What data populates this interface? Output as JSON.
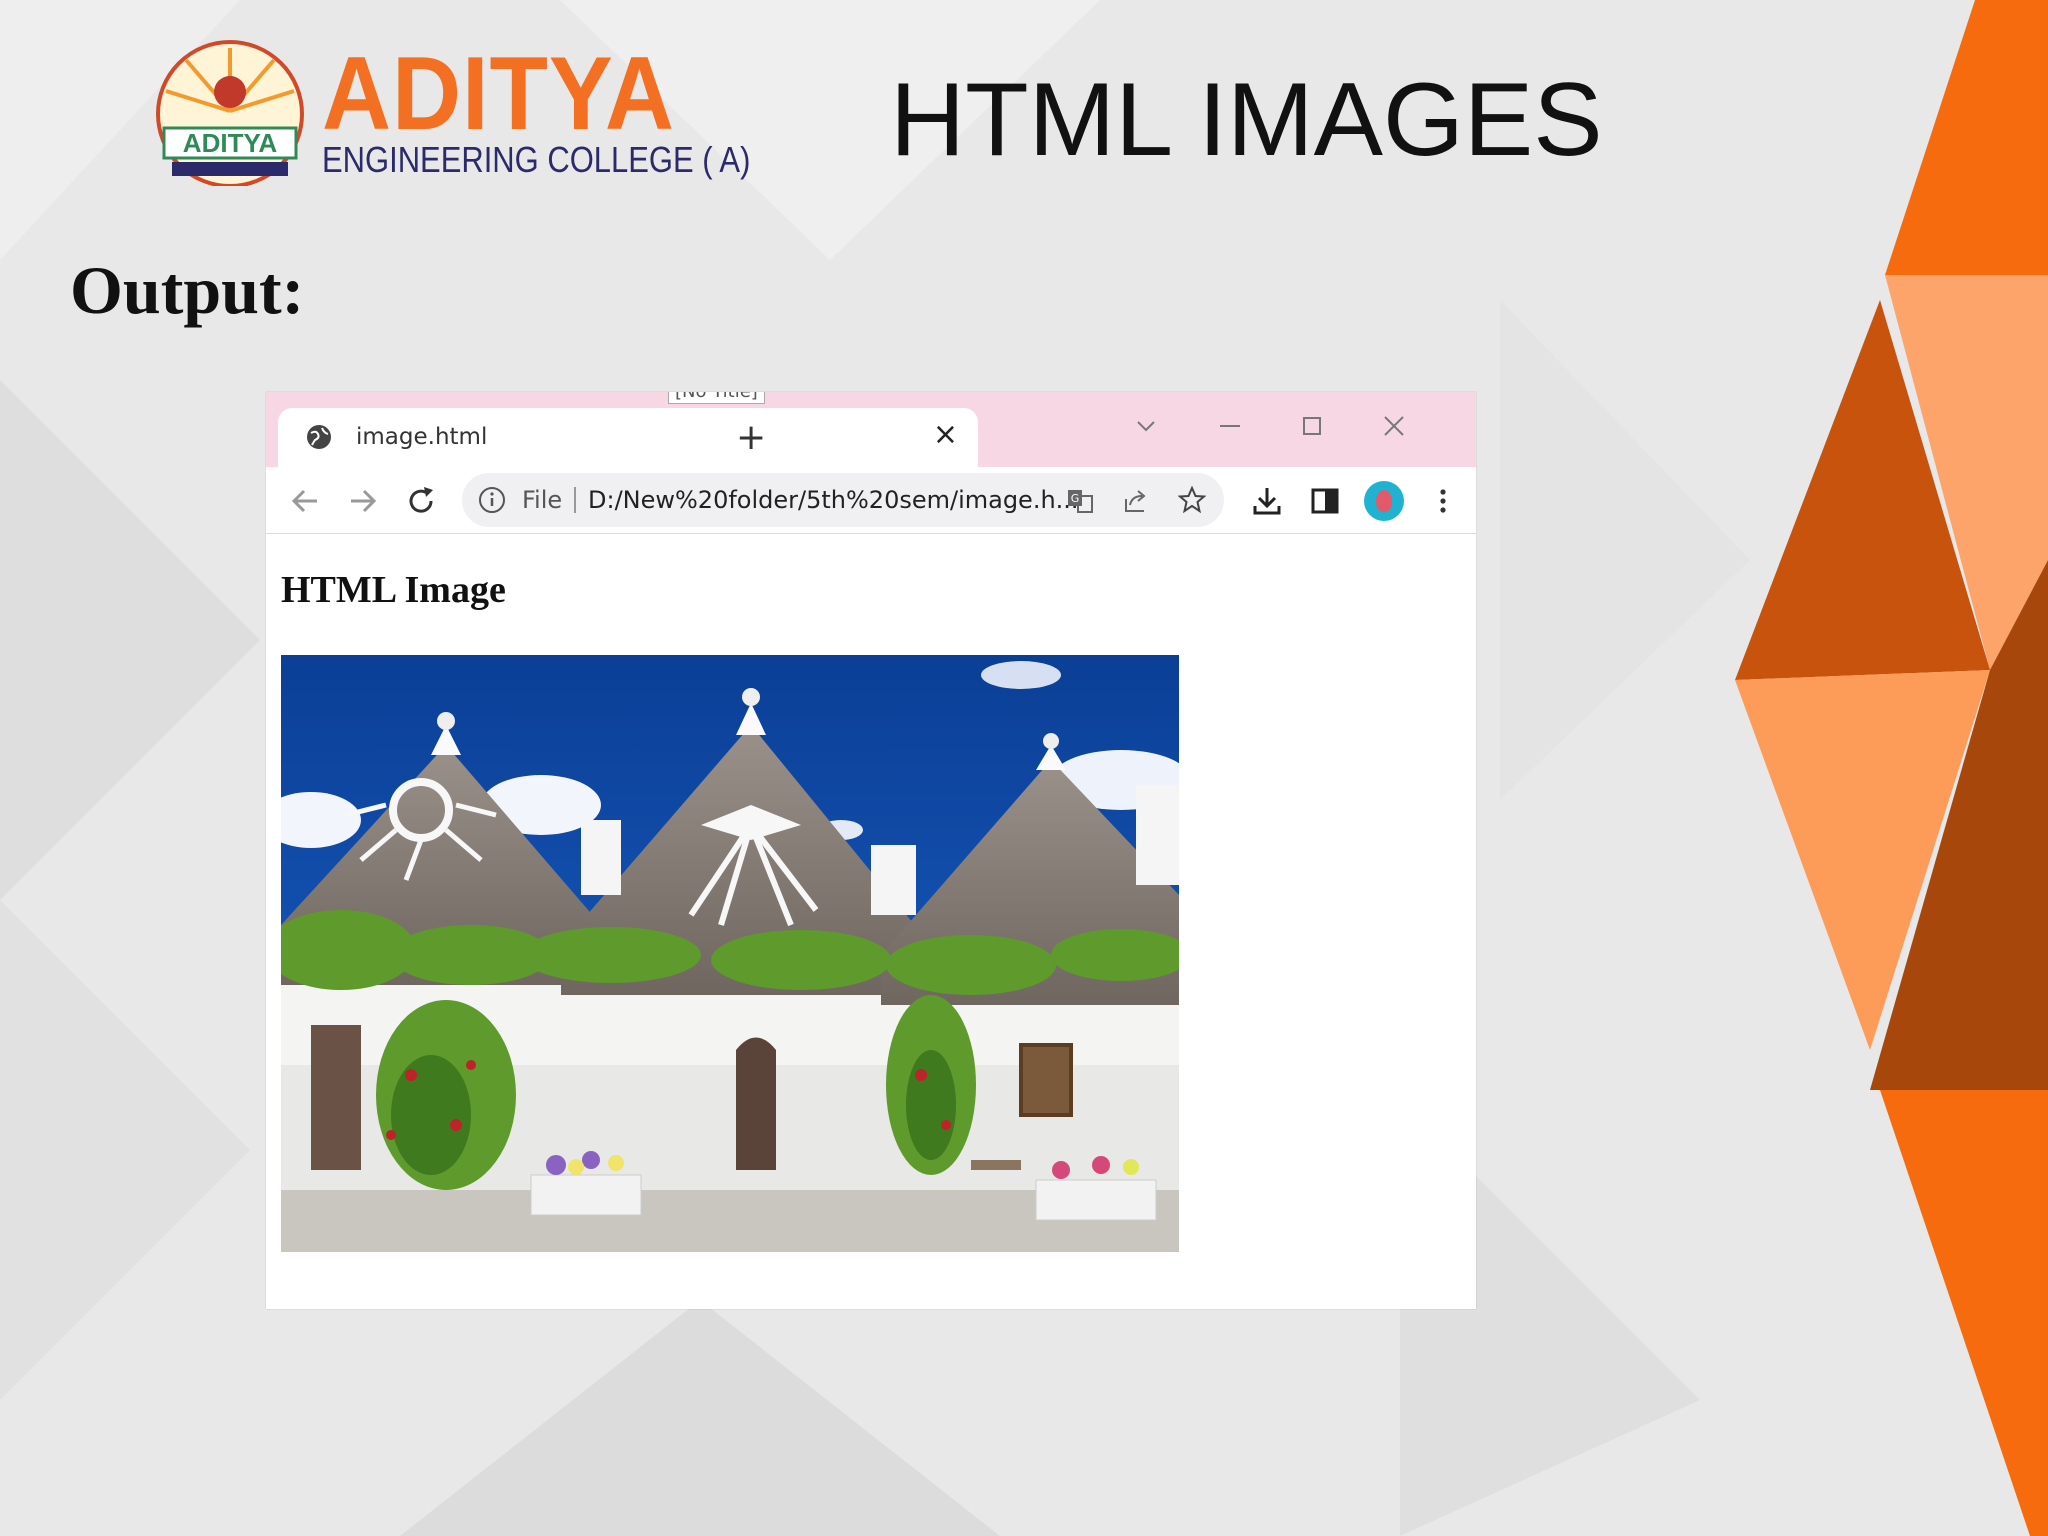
{
  "logo": {
    "name": "ADITYA",
    "subtitle": "ENGINEERING COLLEGE ( A)"
  },
  "slide": {
    "title": "HTML IMAGES",
    "output_label": "Output:"
  },
  "browser": {
    "tooltip": "[No Title]",
    "tab": {
      "title": "image.html",
      "close_glyph": "×"
    },
    "new_tab_glyph": "+",
    "address": {
      "scheme_label": "File",
      "url": "D:/New%20folder/5th%20sem/image.h..."
    },
    "accent": "#1fb3d1",
    "tab_strip_color": "#f7d7e4",
    "page": {
      "heading": "HTML Image"
    }
  },
  "colors": {
    "orange": "#f36f21",
    "navy": "#2b2b6b"
  }
}
